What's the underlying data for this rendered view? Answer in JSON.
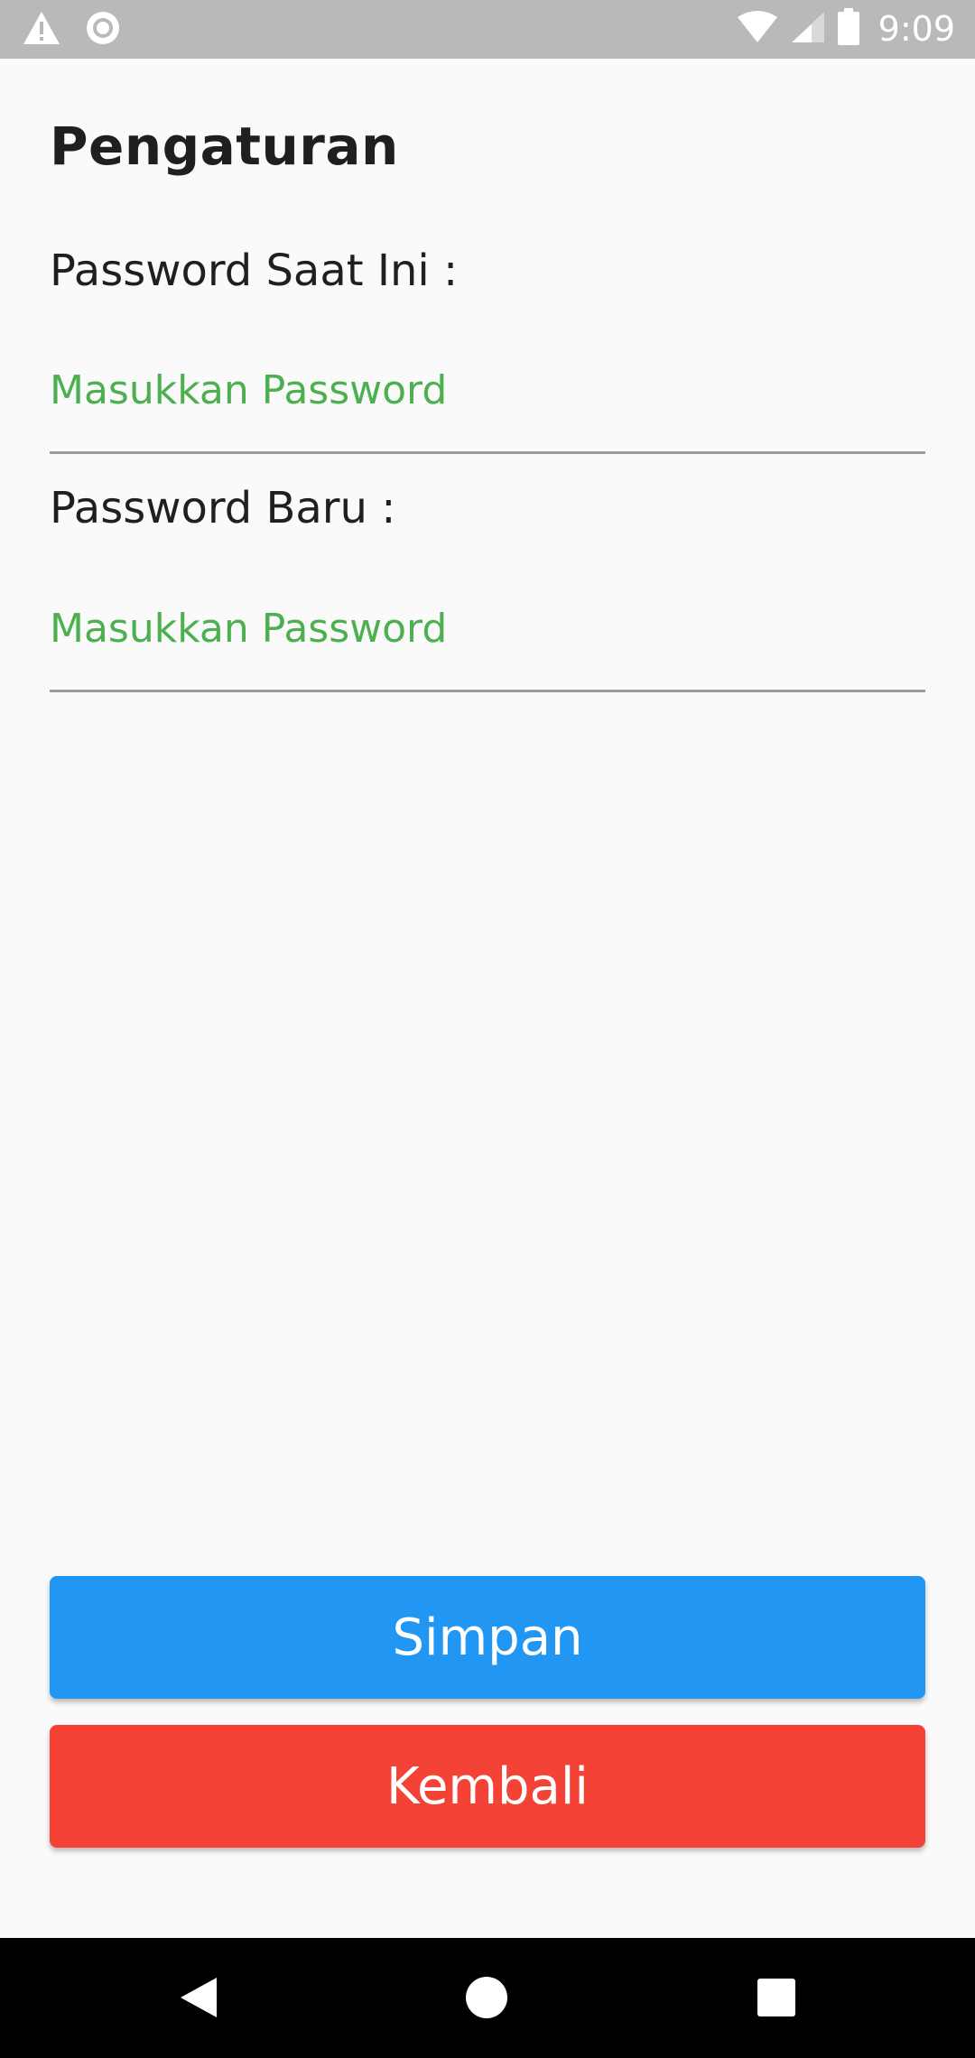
{
  "status_bar": {
    "time": "9:09",
    "icons": [
      "warning-icon",
      "record-icon",
      "wifi-icon",
      "signal-icon",
      "battery-icon"
    ]
  },
  "page": {
    "title": "Pengaturan"
  },
  "form": {
    "current_password": {
      "label": "Password Saat Ini :",
      "placeholder": "Masukkan Password",
      "value": ""
    },
    "new_password": {
      "label": "Password Baru :",
      "placeholder": "Masukkan Password",
      "value": ""
    }
  },
  "actions": {
    "save_label": "Simpan",
    "back_label": "Kembali"
  },
  "colors": {
    "accent_green": "#4caf50",
    "save_blue": "#2196f3",
    "back_red": "#f44336",
    "status_bar": "#b9b9b9",
    "background": "#fafafa"
  },
  "nav_bar": {
    "icons": [
      "back-triangle-icon",
      "home-circle-icon",
      "recents-square-icon"
    ]
  }
}
